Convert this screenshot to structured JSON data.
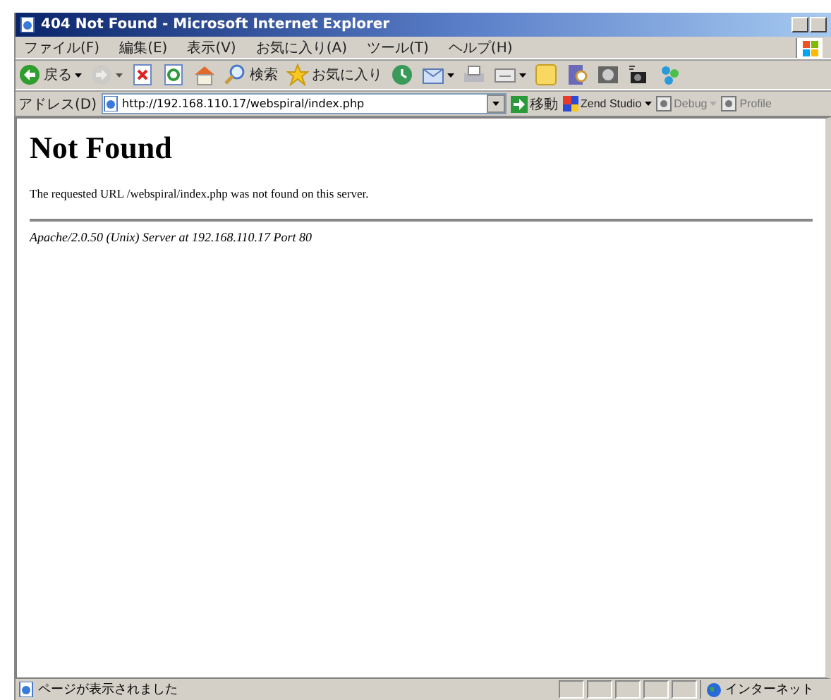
{
  "window": {
    "title": "404 Not Found - Microsoft Internet Explorer"
  },
  "menu": [
    "ファイル(F)",
    "編集(E)",
    "表示(V)",
    "お気に入り(A)",
    "ツール(T)",
    "ヘルプ(H)"
  ],
  "toolbar": [
    {
      "kind": "back",
      "label": "戻る",
      "dropdown": true,
      "disabled": false
    },
    {
      "kind": "forward",
      "dropdown": true,
      "disabled": true
    },
    {
      "kind": "stop",
      "dropdown": false,
      "disabled": false
    },
    {
      "kind": "refresh",
      "dropdown": false,
      "disabled": false
    },
    {
      "kind": "home",
      "dropdown": false,
      "disabled": false
    },
    {
      "kind": "search",
      "label": "検索",
      "dropdown": false,
      "disabled": false
    },
    {
      "kind": "favorites",
      "label": "お気に入り",
      "dropdown": false,
      "disabled": false
    },
    {
      "kind": "history",
      "dropdown": false,
      "disabled": false
    },
    {
      "kind": "mail",
      "dropdown": true,
      "disabled": false
    },
    {
      "kind": "print",
      "dropdown": false,
      "disabled": false
    },
    {
      "kind": "edit",
      "dropdown": true,
      "disabled": false
    },
    {
      "kind": "note",
      "dropdown": false,
      "disabled": false
    },
    {
      "kind": "research",
      "dropdown": false,
      "disabled": false
    },
    {
      "kind": "media",
      "dropdown": false,
      "disabled": false
    },
    {
      "kind": "camera",
      "dropdown": false,
      "disabled": false
    },
    {
      "kind": "messenger",
      "dropdown": false,
      "disabled": false
    }
  ],
  "address": {
    "label": "アドレス(D)",
    "value": "http://192.168.110.17/webspiral/index.php",
    "go": "移動"
  },
  "zend": [
    {
      "label": "Zend Studio",
      "disabled": false,
      "dropdown": true
    },
    {
      "label": "Debug",
      "disabled": true,
      "dropdown": true
    },
    {
      "label": "Profile",
      "disabled": true,
      "dropdown": false
    }
  ],
  "page": {
    "heading": "Not Found",
    "message": "The requested URL /webspiral/index.php was not found on this server.",
    "signature": "Apache/2.0.50 (Unix) Server at 192.168.110.17 Port 80"
  },
  "status_bar": {
    "message": "ページが表示されました",
    "zone": "インターネット"
  }
}
